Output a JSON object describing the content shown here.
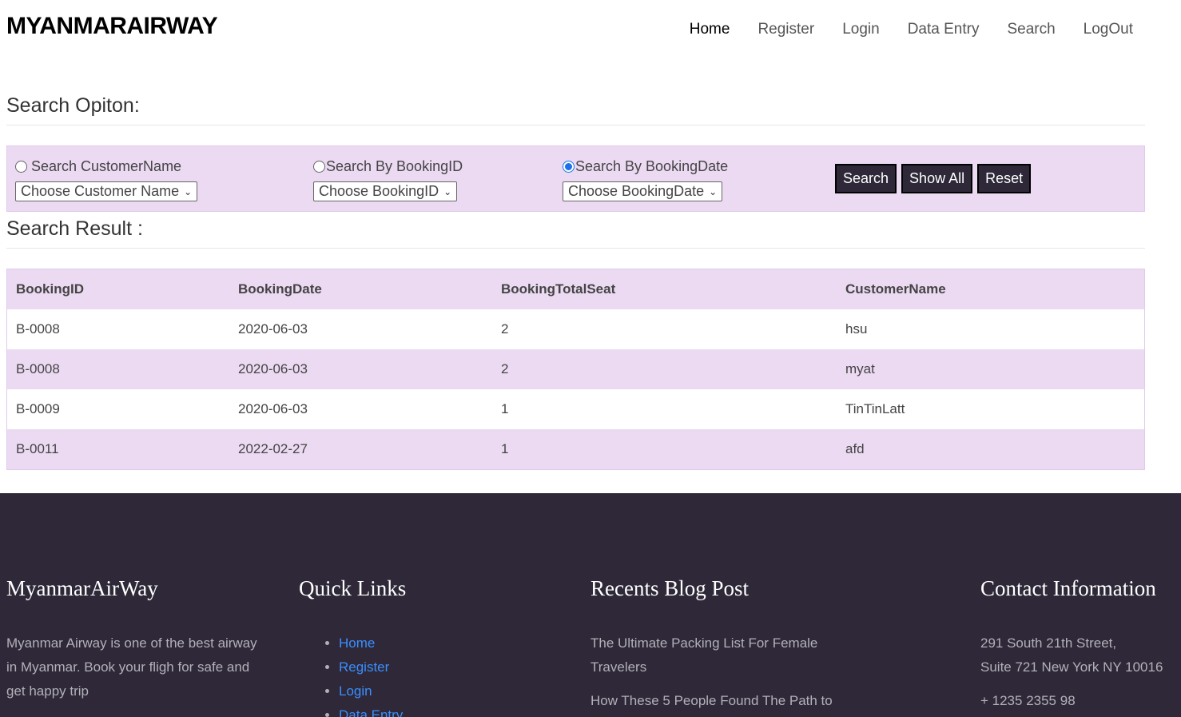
{
  "header": {
    "brand": "MYANMARAIRWAY",
    "nav": [
      "Home",
      "Register",
      "Login",
      "Data Entry",
      "Search",
      "LogOut"
    ]
  },
  "search": {
    "title": "Search Opiton:",
    "options": [
      {
        "label": "Search CustomerName",
        "select": "Choose Customer Name",
        "checked": false
      },
      {
        "label": "Search By BookingID",
        "select": "Choose BookingID",
        "checked": false
      },
      {
        "label": "Search By BookingDate",
        "select": "Choose BookingDate",
        "checked": true
      }
    ],
    "buttons": [
      "Search",
      "Show All",
      "Reset"
    ]
  },
  "result": {
    "title": "Search Result :",
    "columns": [
      "BookingID",
      "BookingDate",
      "BookingTotalSeat",
      "CustomerName"
    ],
    "rows": [
      [
        "B-0008",
        "2020-06-03",
        "2",
        "hsu"
      ],
      [
        "B-0008",
        "2020-06-03",
        "2",
        "myat"
      ],
      [
        "B-0009",
        "2020-06-03",
        "1",
        "TinTinLatt"
      ],
      [
        "B-0011",
        "2022-02-27",
        "1",
        "afd"
      ]
    ]
  },
  "footer": {
    "about_title": "MyanmarAirWay",
    "about_text": "Myanmar Airway is one of the best airway in Myanmar. Book your fligh for safe and get happy trip",
    "links_title": "Quick Links",
    "links": [
      "Home",
      "Register",
      "Login",
      "Data Entry"
    ],
    "blog_title": "Recents Blog Post",
    "posts": [
      "The Ultimate Packing List For Female Travelers",
      "How These 5 People Found The Path to"
    ],
    "contact_title": "Contact Information",
    "address_line1": "291 South 21th Street,",
    "address_line2": "Suite 721 New York NY 10016",
    "phone": "+ 1235 2355 98"
  },
  "colors": {
    "panel": "#ecdaf3",
    "footer": "#2e2838",
    "link": "#3b8fff"
  }
}
